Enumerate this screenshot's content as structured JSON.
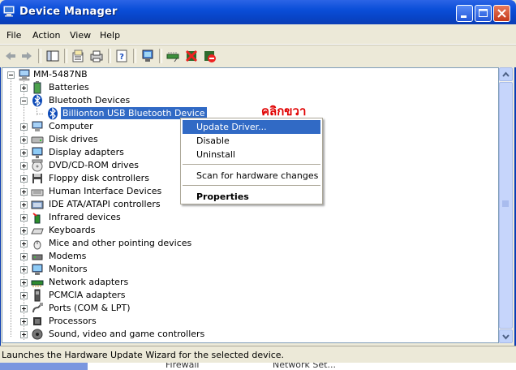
{
  "window": {
    "title": "Device Manager",
    "controls": [
      "minimize-icon",
      "maximize-icon",
      "close-icon"
    ]
  },
  "menubar": {
    "items": [
      "File",
      "Action",
      "View",
      "Help"
    ]
  },
  "toolbar": {
    "icons": [
      "back-icon",
      "forward-icon",
      "show-hide-tree-icon",
      "properties-icon",
      "print-icon",
      "help-icon",
      "scan-hardware-icon",
      "update-driver-icon",
      "uninstall-icon",
      "disable-icon"
    ]
  },
  "tree": {
    "root": "MM-5487NB",
    "items": [
      {
        "label": "Batteries",
        "icon": "battery-icon"
      },
      {
        "label": "Bluetooth Devices",
        "icon": "bluetooth-icon",
        "expanded": true
      },
      {
        "label": "Billionton USB Bluetooth Device",
        "icon": "bluetooth-icon",
        "child": true,
        "selected": true
      },
      {
        "label": "Computer",
        "icon": "computer-icon"
      },
      {
        "label": "Disk drives",
        "icon": "disk-icon"
      },
      {
        "label": "Display adapters",
        "icon": "display-icon"
      },
      {
        "label": "DVD/CD-ROM drives",
        "icon": "cdrom-icon"
      },
      {
        "label": "Floppy disk controllers",
        "icon": "floppy-icon"
      },
      {
        "label": "Human Interface Devices",
        "icon": "hid-icon"
      },
      {
        "label": "IDE ATA/ATAPI controllers",
        "icon": "ide-icon"
      },
      {
        "label": "Infrared devices",
        "icon": "infrared-icon"
      },
      {
        "label": "Keyboards",
        "icon": "keyboard-icon"
      },
      {
        "label": "Mice and other pointing devices",
        "icon": "mouse-icon"
      },
      {
        "label": "Modems",
        "icon": "modem-icon"
      },
      {
        "label": "Monitors",
        "icon": "monitor-icon"
      },
      {
        "label": "Network adapters",
        "icon": "network-icon"
      },
      {
        "label": "PCMCIA adapters",
        "icon": "pcmcia-icon"
      },
      {
        "label": "Ports (COM & LPT)",
        "icon": "port-icon"
      },
      {
        "label": "Processors",
        "icon": "processor-icon"
      },
      {
        "label": "Sound, video and game controllers",
        "icon": "sound-icon"
      }
    ]
  },
  "context_menu": {
    "update_driver": "Update Driver...",
    "disable": "Disable",
    "uninstall": "Uninstall",
    "scan": "Scan for hardware changes",
    "properties": "Properties"
  },
  "annotation": "คลิกขวา",
  "status_bar": "Launches the Hardware Update Wizard for the selected device.",
  "taskbar_fragment": {
    "left": "Firewall",
    "right": "Network Set..."
  },
  "colors": {
    "titlebar": "#0A4ED8",
    "selection": "#316AC5",
    "annotation": "#E00000",
    "chrome": "#ECE9D8"
  }
}
